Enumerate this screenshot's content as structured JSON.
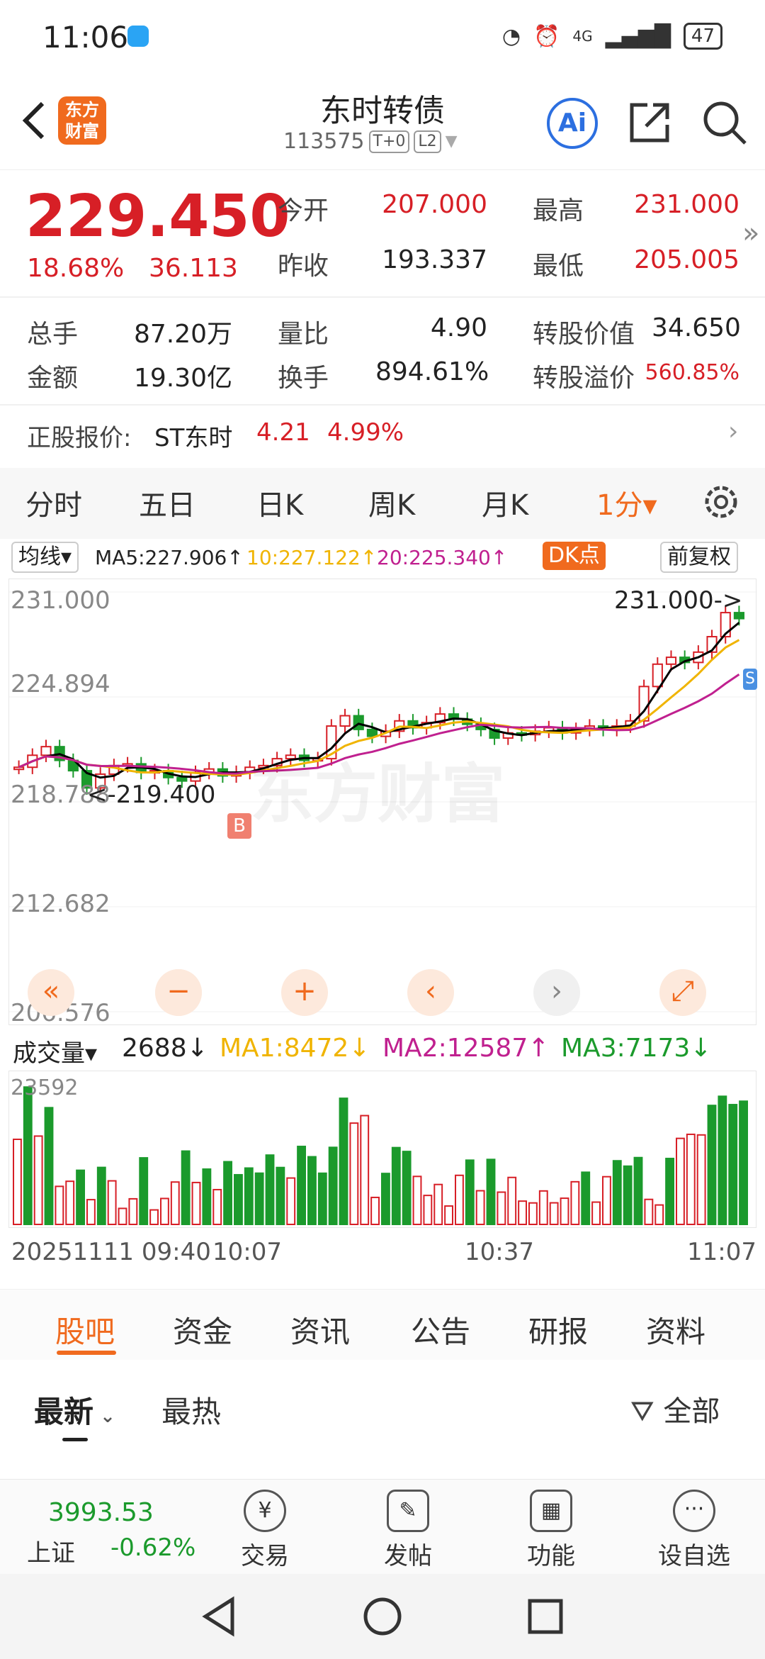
{
  "status": {
    "time": "11:06",
    "battery": "47",
    "network": "4G"
  },
  "header": {
    "title": "东时转债",
    "code": "113575",
    "tag1": "T+0",
    "tag2": "L2",
    "logo_line1": "东方",
    "logo_line2": "财富",
    "ai_label": "Ai"
  },
  "quote": {
    "price": "229.450",
    "change_pct": "18.68%",
    "change": "36.113",
    "open_label": "今开",
    "open": "207.000",
    "high_label": "最高",
    "high": "231.000",
    "prev_label": "昨收",
    "prev": "193.337",
    "low_label": "最低",
    "low": "205.005",
    "vol_label": "总手",
    "vol": "87.20万",
    "ratio_label": "量比",
    "ratio": "4.90",
    "convval_label": "转股价值",
    "convval": "34.650",
    "amt_label": "金额",
    "amt": "19.30亿",
    "turnover_label": "换手",
    "turnover": "894.61%",
    "premium_label": "转股溢价",
    "premium": "560.85%"
  },
  "stock": {
    "label": "正股报价:",
    "name": "ST东时",
    "price": "4.21",
    "pct": "4.99%"
  },
  "period_tabs": [
    "分时",
    "五日",
    "日K",
    "周K",
    "月K",
    "1分▾"
  ],
  "ma": {
    "selector": "均线▾",
    "ma5": "MA5:227.906↑",
    "ma10": "10:227.122↑",
    "ma20": "20:225.340↑",
    "dk": "DK点",
    "adjust": "前复权"
  },
  "chart": {
    "y_labels": [
      "231.000",
      "224.894",
      "218.788",
      "212.682",
      "206.576"
    ],
    "high_marker": "231.000->",
    "low_marker": "<-219.400",
    "buy_marker": "B",
    "sell_marker": "S",
    "watermark": "东方财富"
  },
  "volume": {
    "selector": "成交量▾",
    "current": "2688↓",
    "ma1": "MA1:8472↓",
    "ma2": "MA2:12587↑",
    "ma3": "MA3:7173↓",
    "max_label": "23592"
  },
  "time_axis": [
    "20251111 09:40",
    "10:07",
    "10:37",
    "11:07"
  ],
  "info_tabs": [
    "股吧",
    "资金",
    "资讯",
    "公告",
    "研报",
    "资料"
  ],
  "sub_tabs": {
    "latest": "最新",
    "hot": "最热",
    "filter": "全部"
  },
  "bottom": {
    "index_value": "3993.53",
    "index_name": "上证",
    "index_pct": "-0.62%",
    "items": [
      "交易",
      "发帖",
      "功能",
      "设自选"
    ]
  },
  "colors": {
    "up": "#d71f26",
    "down": "#1b9a2c",
    "accent": "#f06a1e",
    "ma5": "#000000",
    "ma10": "#f0b400",
    "ma20": "#c0208f"
  },
  "chart_data": {
    "type": "candlestick",
    "ylim": [
      206.576,
      231.0
    ],
    "price_path": [
      220.8,
      221.5,
      222.0,
      221.2,
      220.6,
      219.6,
      220.4,
      220.9,
      221.0,
      220.5,
      220.6,
      220.2,
      220.0,
      220.5,
      220.7,
      220.3,
      220.5,
      220.8,
      220.9,
      221.3,
      221.5,
      221.2,
      221.3,
      223.2,
      223.8,
      223.0,
      222.6,
      222.9,
      223.5,
      223.1,
      223.4,
      223.9,
      223.6,
      223.3,
      223.0,
      222.5,
      222.8,
      222.7,
      222.9,
      223.1,
      222.8,
      223.0,
      223.2,
      223.0,
      223.2,
      223.5,
      225.5,
      226.8,
      227.2,
      226.9,
      227.5,
      228.4,
      229.8,
      229.45
    ]
  }
}
